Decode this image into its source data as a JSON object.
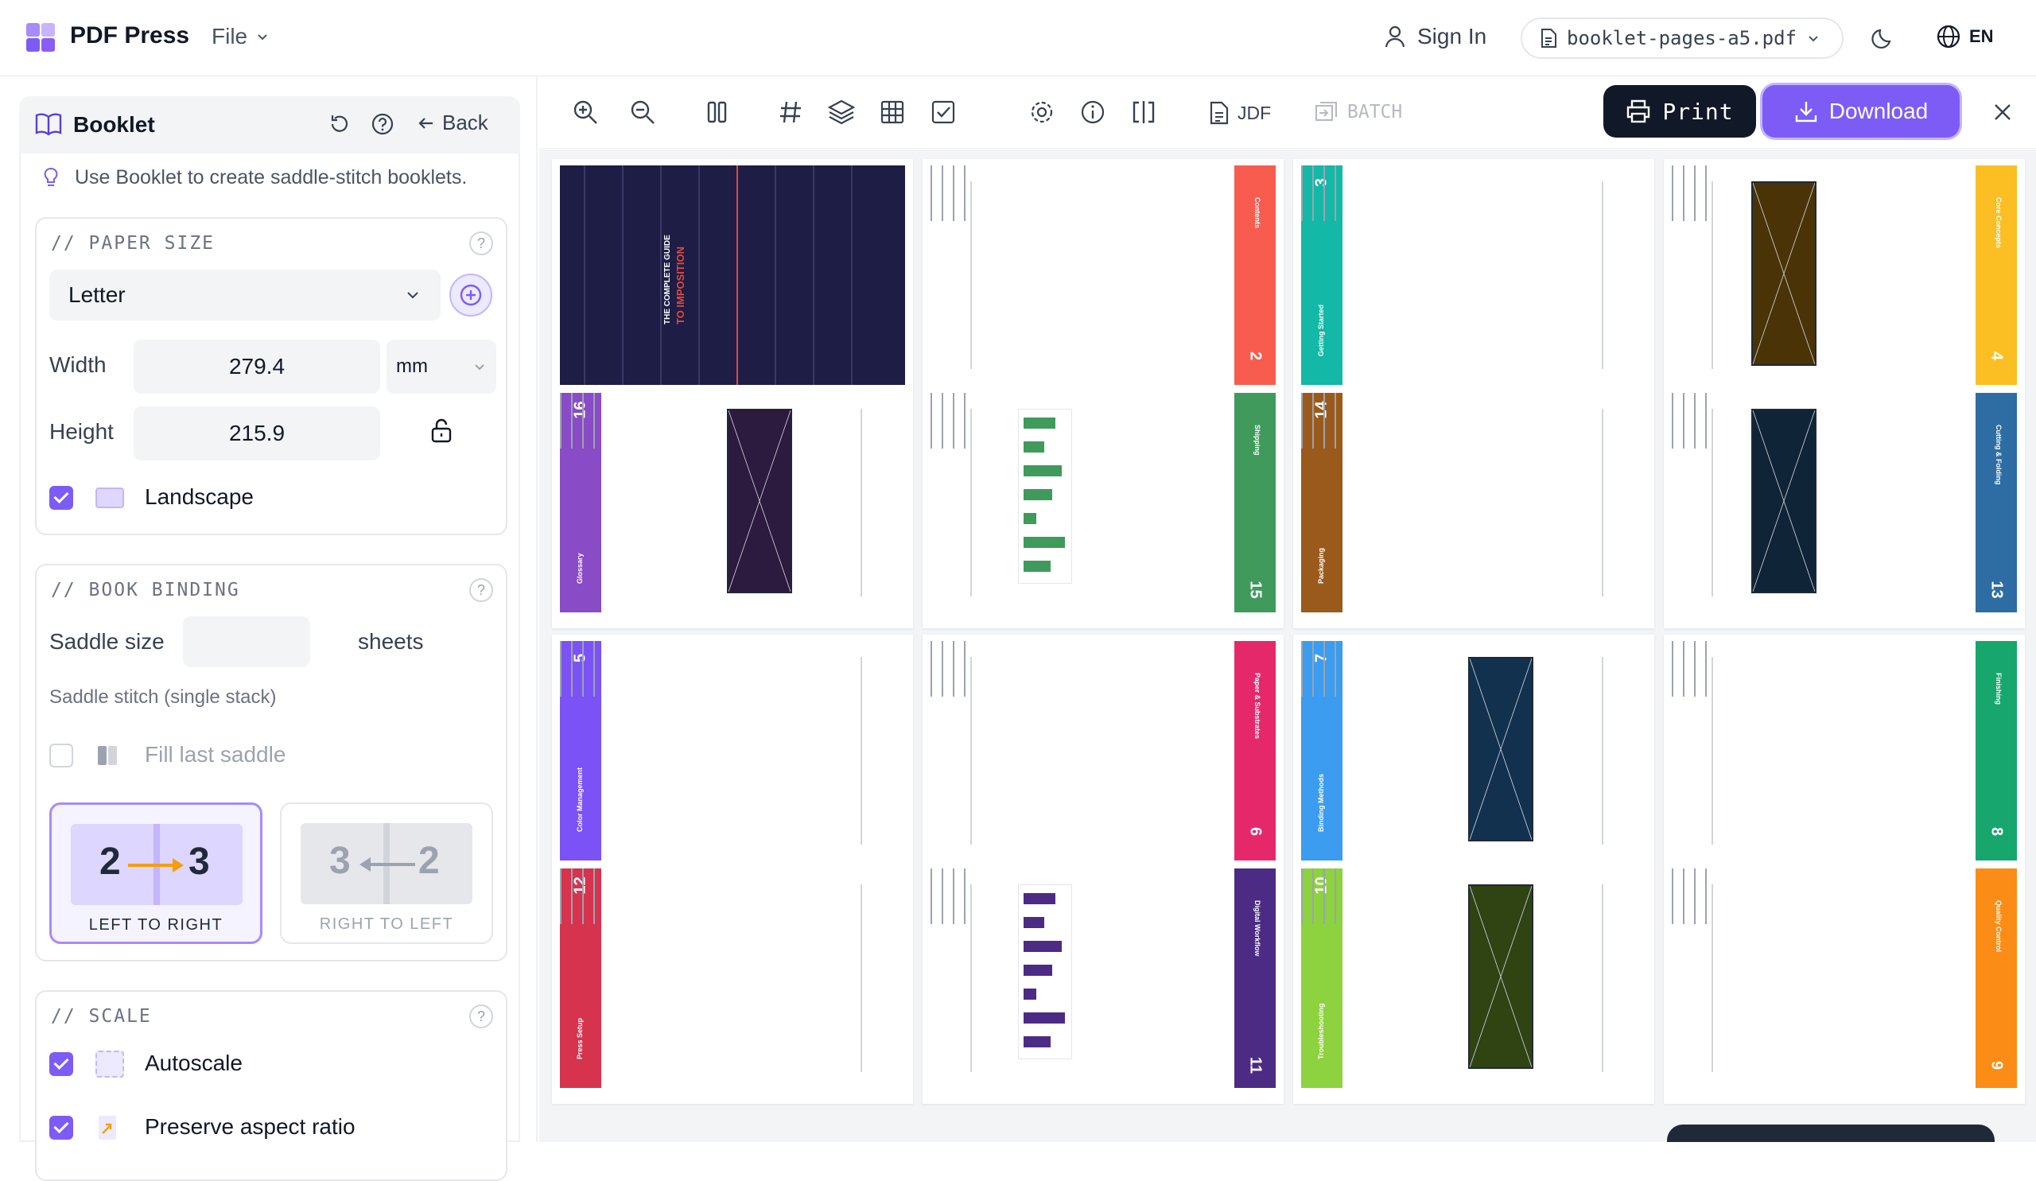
{
  "header": {
    "app_title": "PDF Press",
    "file_menu": "File",
    "sign_in": "Sign In",
    "file_name": "booklet-pages-a5.pdf",
    "language": "EN"
  },
  "panel": {
    "title": "Booklet",
    "back": "Back",
    "hint": "Use Booklet to create saddle-stitch booklets."
  },
  "paper_size": {
    "title": "// PAPER SIZE",
    "help": "?",
    "preset": "Letter",
    "width_label": "Width",
    "width_value": "279.4",
    "unit": "mm",
    "height_label": "Height",
    "height_value": "215.9",
    "landscape_label": "Landscape",
    "landscape_checked": true
  },
  "binding": {
    "title": "// BOOK BINDING",
    "help": "?",
    "saddle_label": "Saddle size",
    "saddle_value": "",
    "saddle_unit": "sheets",
    "mode_text": "Saddle stitch (single stack)",
    "fill_label": "Fill last saddle",
    "fill_checked": false,
    "directions": [
      {
        "label": "LEFT TO RIGHT",
        "from": "2",
        "to": "3",
        "selected": true
      },
      {
        "label": "RIGHT TO LEFT",
        "from": "3",
        "to": "2",
        "selected": false
      }
    ]
  },
  "scale": {
    "title": "// SCALE",
    "help": "?",
    "autoscale_label": "Autoscale",
    "autoscale_checked": true,
    "aspect_label": "Preserve aspect ratio",
    "aspect_checked": true
  },
  "toolbar": {
    "jdf": "JDF",
    "batch": "BATCH",
    "print": "Print",
    "download": "Download"
  },
  "cover": {
    "title": "THE COMPLETE GUIDE",
    "subtitle": "TO IMPOSITION"
  },
  "colors": {
    "accent": "#7c5cf5",
    "cover": "#1e1d45"
  },
  "sheets": [
    {
      "top": {
        "num": "",
        "section": "",
        "color": "#1e1d45",
        "cover": true
      },
      "bottom": {
        "num": "16",
        "section": "Glossary",
        "color": "#8a4bc6",
        "image": "#2c1a3f"
      }
    },
    {
      "top": {
        "num": "2",
        "section": "Contents",
        "color": "#f85c4f"
      },
      "bottom": {
        "num": "15",
        "section": "Shipping",
        "color": "#3f9a5b",
        "chart": "#3f9a5b"
      }
    },
    {
      "top": {
        "num": "3",
        "section": "Getting Started",
        "color": "#14b8a6"
      },
      "bottom": {
        "num": "14",
        "section": "Packaging",
        "color": "#9a5a1c"
      }
    },
    {
      "top": {
        "num": "4",
        "section": "Core Concepts",
        "color": "#fbbf24",
        "image": "#4a3306"
      },
      "bottom": {
        "num": "13",
        "section": "Cutting & Folding",
        "color": "#2d6da3",
        "image": "#0f2436"
      }
    },
    {
      "top": {
        "num": "5",
        "section": "Color Management",
        "color": "#7b52f5"
      },
      "bottom": {
        "num": "12",
        "section": "Press Setup",
        "color": "#d6334e"
      }
    },
    {
      "top": {
        "num": "6",
        "section": "Paper & Substrates",
        "color": "#e5286a"
      },
      "bottom": {
        "num": "11",
        "section": "Digital Workflow",
        "color": "#4c2b84",
        "chart": "#4c2b84"
      }
    },
    {
      "top": {
        "num": "7",
        "section": "Binding Methods",
        "color": "#3b9cf0",
        "image": "#12314f"
      },
      "bottom": {
        "num": "10",
        "section": "Troubleshooting",
        "color": "#8dd23f",
        "image": "#2f4313"
      }
    },
    {
      "top": {
        "num": "8",
        "section": "Finishing",
        "color": "#16a66e"
      },
      "bottom": {
        "num": "9",
        "section": "Quality Control",
        "color": "#fb8c16"
      }
    }
  ]
}
